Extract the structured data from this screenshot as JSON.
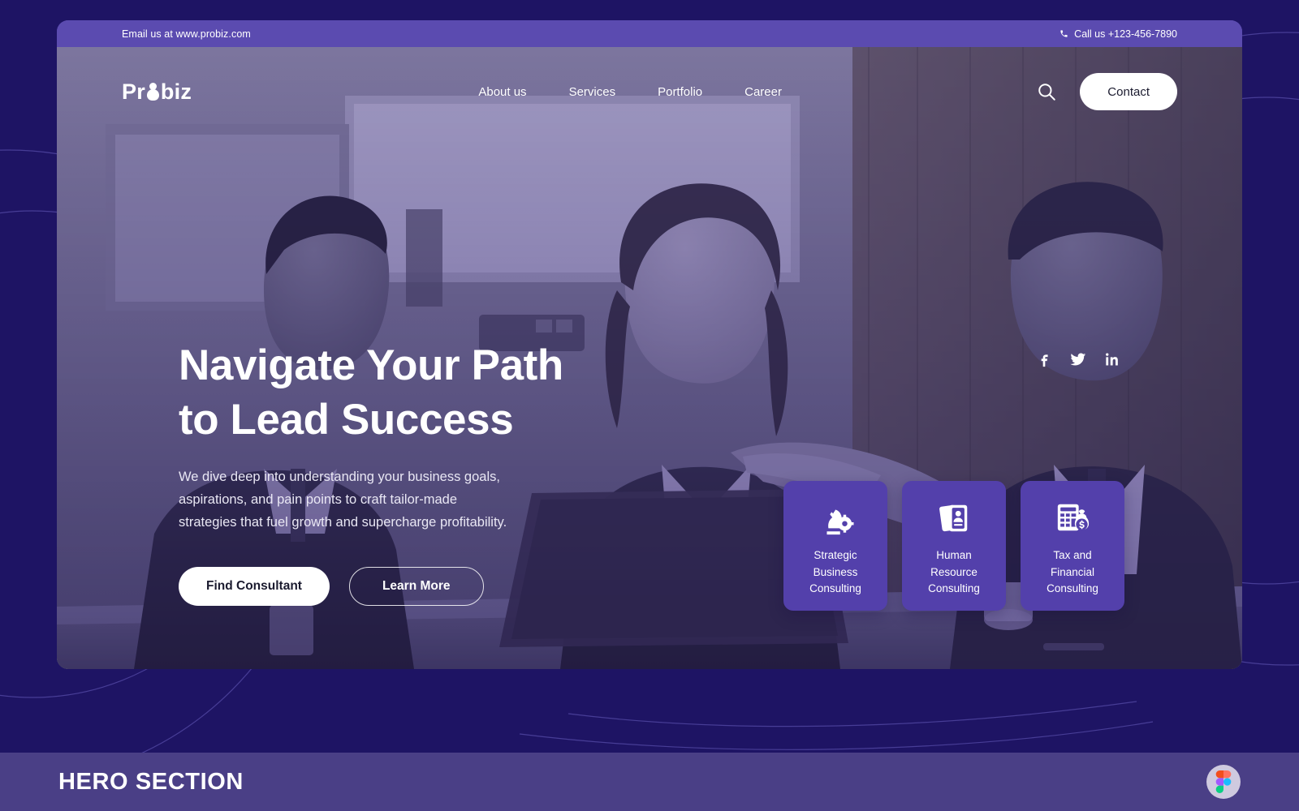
{
  "colors": {
    "page_background": "#1e1464",
    "bar_purple": "#5b4bb0",
    "card_purple": "#5340ab",
    "footer_purple": "#4a3f86",
    "white": "#ffffff"
  },
  "topbar": {
    "email_text": "Email us at www.probiz.com",
    "phone_text": "Call us +123-456-7890",
    "phone_icon": "phone-icon"
  },
  "nav": {
    "logo_text_before": "Pr",
    "logo_text_after": "biz",
    "logo_mark": "person-icon",
    "links": [
      {
        "label": "About us"
      },
      {
        "label": "Services"
      },
      {
        "label": "Portfolio"
      },
      {
        "label": "Career"
      }
    ],
    "search_icon": "search-icon",
    "contact_label": "Contact"
  },
  "hero": {
    "headline_line1": "Navigate Your Path",
    "headline_line2": "to Lead Success",
    "subcopy_line1": "We dive deep into understanding your business goals,",
    "subcopy_line2": "aspirations, and pain points to craft tailor-made",
    "subcopy_line3": "strategies that fuel growth and supercharge profitability.",
    "primary_cta": "Find Consultant",
    "secondary_cta": "Learn More"
  },
  "socials": [
    {
      "name": "facebook-icon",
      "label": "Facebook"
    },
    {
      "name": "twitter-icon",
      "label": "Twitter"
    },
    {
      "name": "linkedin-icon",
      "label": "LinkedIn"
    }
  ],
  "service_cards": [
    {
      "icon": "chess-knight-gear-icon",
      "line1": "Strategic",
      "line2": "Business",
      "line3": "Consulting"
    },
    {
      "icon": "id-card-icon",
      "line1": "Human",
      "line2": "Resource",
      "line3": "Consulting"
    },
    {
      "icon": "invoice-money-icon",
      "line1": "Tax and",
      "line2": "Financial",
      "line3": "Consulting"
    }
  ],
  "footer": {
    "title": "HERO SECTION",
    "badge_icon": "figma-logo-icon"
  }
}
